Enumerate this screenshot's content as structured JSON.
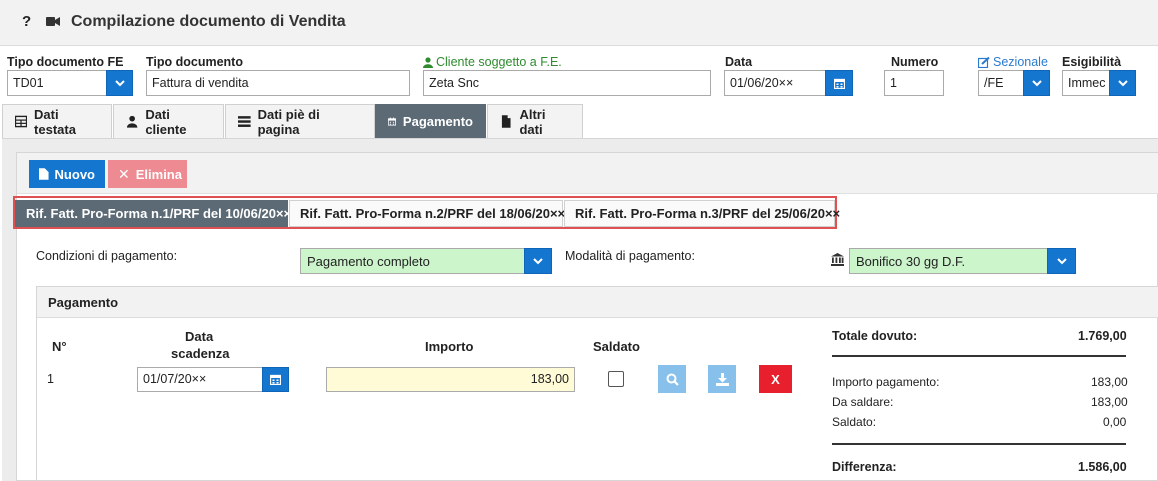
{
  "title": {
    "help": "?",
    "text": "Compilazione documento di Vendita"
  },
  "header": {
    "tipo_fe_label": "Tipo documento FE",
    "tipo_fe_value": "TD01",
    "tipo_doc_label": "Tipo documento",
    "tipo_doc_value": "Fattura di vendita",
    "cliente_label": "Cliente soggetto a F.E.",
    "cliente_value": "Zeta Snc",
    "data_label": "Data",
    "data_value": "01/06/20××",
    "numero_label": "Numero",
    "numero_value": "1",
    "sezionale_label": "Sezionale",
    "sezionale_value": "/FE",
    "esigibilita_label": "Esigibilità",
    "esigibilita_value": "Immec"
  },
  "tabs": [
    {
      "label": "Dati testata",
      "icon": "table-icon"
    },
    {
      "label": "Dati cliente",
      "icon": "user-icon"
    },
    {
      "label": "Dati piè di pagina",
      "icon": "list-icon"
    },
    {
      "label": "Pagamento",
      "icon": "calendar-icon"
    },
    {
      "label": "Altri dati",
      "icon": "file-icon"
    }
  ],
  "toolbar": {
    "new_label": "Nuovo",
    "delete_label": "Elimina"
  },
  "subtabs": [
    "Rif. Fatt. Pro-Forma n.1/PRF del 10/06/20××",
    "Rif. Fatt. Pro-Forma n.2/PRF del 18/06/20××",
    "Rif. Fatt. Pro-Forma n.3/PRF del 25/06/20××"
  ],
  "conditions": {
    "cond_label": "Condizioni di pagamento:",
    "cond_value": "Pagamento completo",
    "mode_label": "Modalità di pagamento:",
    "mode_value": "Bonifico 30 gg D.F."
  },
  "payment": {
    "title": "Pagamento",
    "col_n": "N°",
    "col_data_1": "Data",
    "col_data_2": "scadenza",
    "col_importo": "Importo",
    "col_saldato": "Saldato",
    "row_n": "1",
    "row_date": "01/07/20××",
    "row_amount": "183,00",
    "delete_label": "X"
  },
  "summary": {
    "totale_label": "Totale dovuto:",
    "totale_value": "1.769,00",
    "importo_label": "Importo pagamento:",
    "importo_value": "183,00",
    "da_saldare_label": "Da saldare:",
    "da_saldare_value": "183,00",
    "saldato_label": "Saldato:",
    "saldato_value": "0,00",
    "diff_label": "Differenza:",
    "diff_value": "1.586,00"
  },
  "colors": {
    "accent_blue": "#1576d0",
    "active_tab": "#5b6a75",
    "danger_red": "#e8202e",
    "green_select": "#ccf5cc",
    "amount_yellow": "#fffbd6"
  }
}
